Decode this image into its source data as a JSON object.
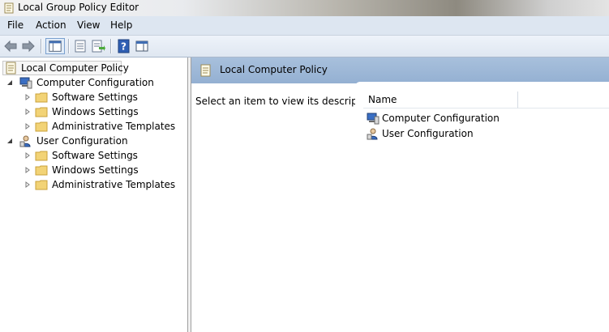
{
  "window": {
    "title": "Local Group Policy Editor"
  },
  "menu": [
    "File",
    "Action",
    "View",
    "Help"
  ],
  "toolbar": {
    "buttons": [
      "back-icon",
      "forward-icon",
      "show-hide-tree-icon",
      "properties-icon",
      "export-list-icon",
      "help-icon",
      "show-hide-action-pane-icon"
    ]
  },
  "tree": {
    "root": "Local Computer Policy",
    "computer_config": {
      "label": "Computer Configuration",
      "children": [
        "Software Settings",
        "Windows Settings",
        "Administrative Templates"
      ]
    },
    "user_config": {
      "label": "User Configuration",
      "children": [
        "Software Settings",
        "Windows Settings",
        "Administrative Templates"
      ]
    }
  },
  "main": {
    "header_title": "Local Computer Policy",
    "description": "Select an item to view its description.",
    "column_name": "Name",
    "items": [
      "Computer Configuration",
      "User Configuration"
    ]
  },
  "colors": {
    "menubar": "#dde6f1",
    "header": "#a8c0dc",
    "folder": "#f2d376"
  }
}
